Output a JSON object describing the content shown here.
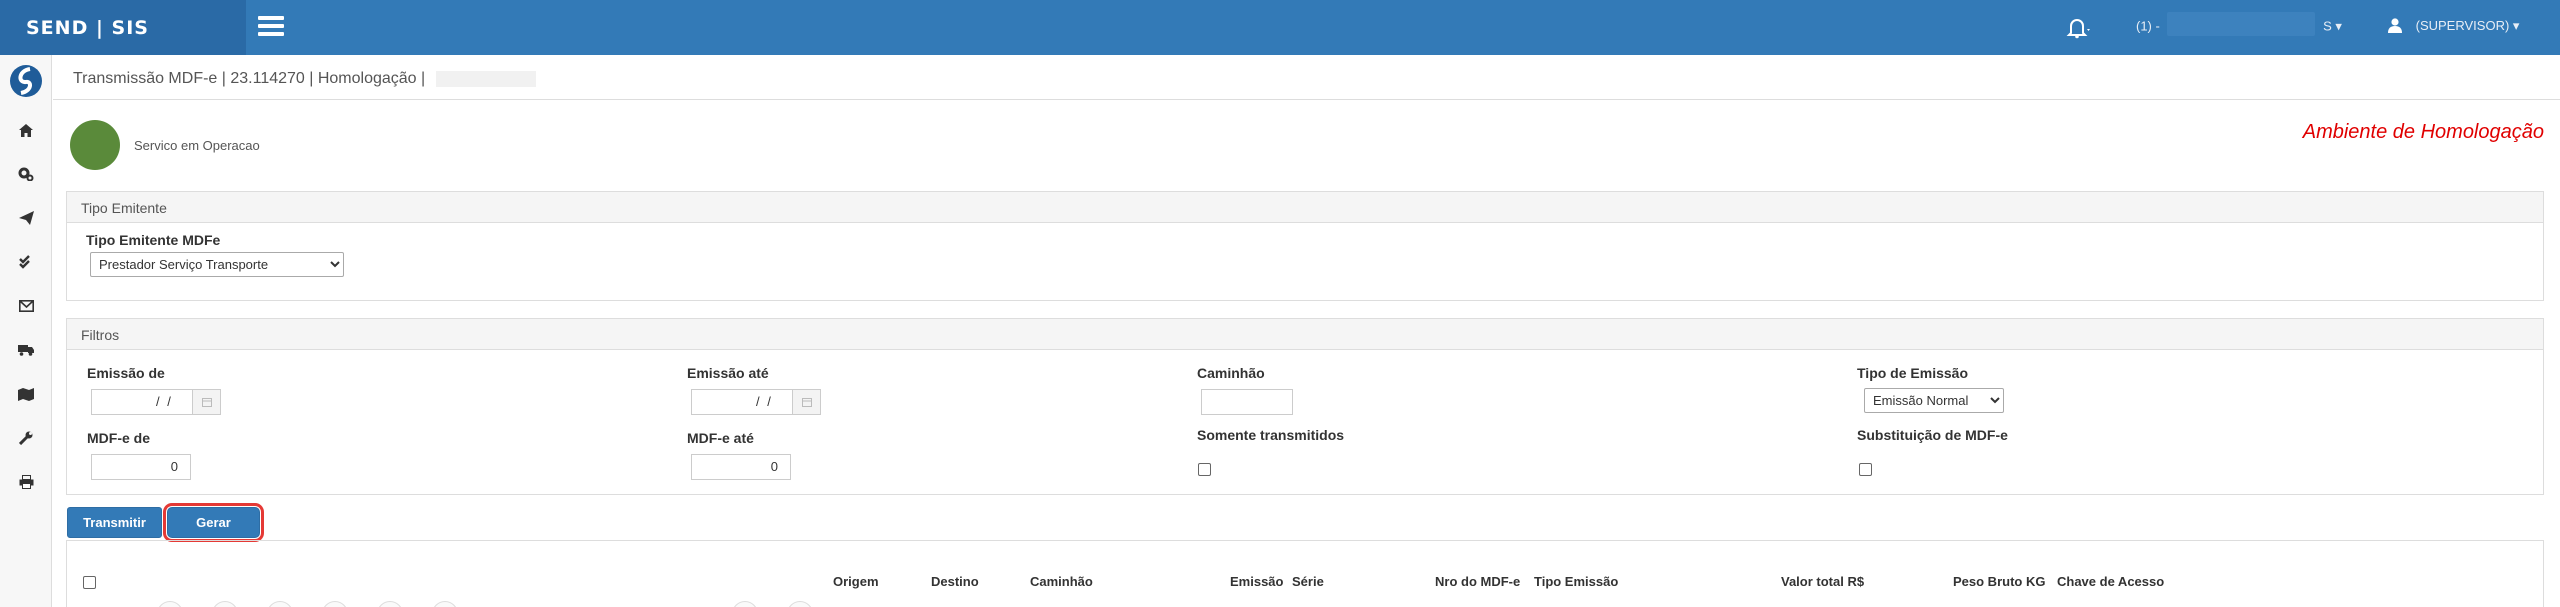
{
  "header": {
    "brand": "SEND | SIS",
    "company_prefix": "(1) -",
    "company_suffix": "S",
    "user": "(SUPERVISOR)",
    "icons": [
      "menu-icon",
      "bell-icon",
      "user-icon"
    ]
  },
  "sidebar": {
    "items": [
      "home-icon",
      "cogs-icon",
      "send-icon",
      "check-double-icon",
      "envelope-icon",
      "truck-icon",
      "map-icon",
      "wrench-icon",
      "print-icon"
    ]
  },
  "page": {
    "title": "Transmissão MDF-e | 23.114270 | Homologação |",
    "status": "Servico em Operacao",
    "environment": "Ambiente de Homologação"
  },
  "colors": {
    "brand": "#337ab7",
    "status_ok": "#5a8a3a",
    "env_text": "#e00000"
  },
  "tipo_emitente": {
    "panel_title": "Tipo Emitente",
    "label": "Tipo Emitente MDFe",
    "selected": "Prestador Serviço Transporte"
  },
  "filtros": {
    "panel_title": "Filtros",
    "emissao_de_label": "Emissão de",
    "emissao_de_value": "/ /",
    "emissao_ate_label": "Emissão até",
    "emissao_ate_value": "/ /",
    "caminhao_label": "Caminhão",
    "caminhao_value": "",
    "tipo_emissao_label": "Tipo de Emissão",
    "tipo_emissao_selected": "Emissão Normal",
    "mdfe_de_label": "MDF-e de",
    "mdfe_de_value": "0",
    "mdfe_ate_label": "MDF-e até",
    "mdfe_ate_value": "0",
    "somente_transmitidos_label": "Somente transmitidos",
    "substituicao_label": "Substituição de MDF-e"
  },
  "actions": {
    "transmitir": "Transmitir",
    "gerar": "Gerar"
  },
  "table": {
    "columns": [
      "Origem",
      "Destino",
      "Caminhão",
      "Emissão",
      "Série",
      "Nro do MDF-e",
      "Tipo Emissão",
      "Valor total R$",
      "Peso Bruto KG",
      "Chave de Acesso"
    ]
  }
}
